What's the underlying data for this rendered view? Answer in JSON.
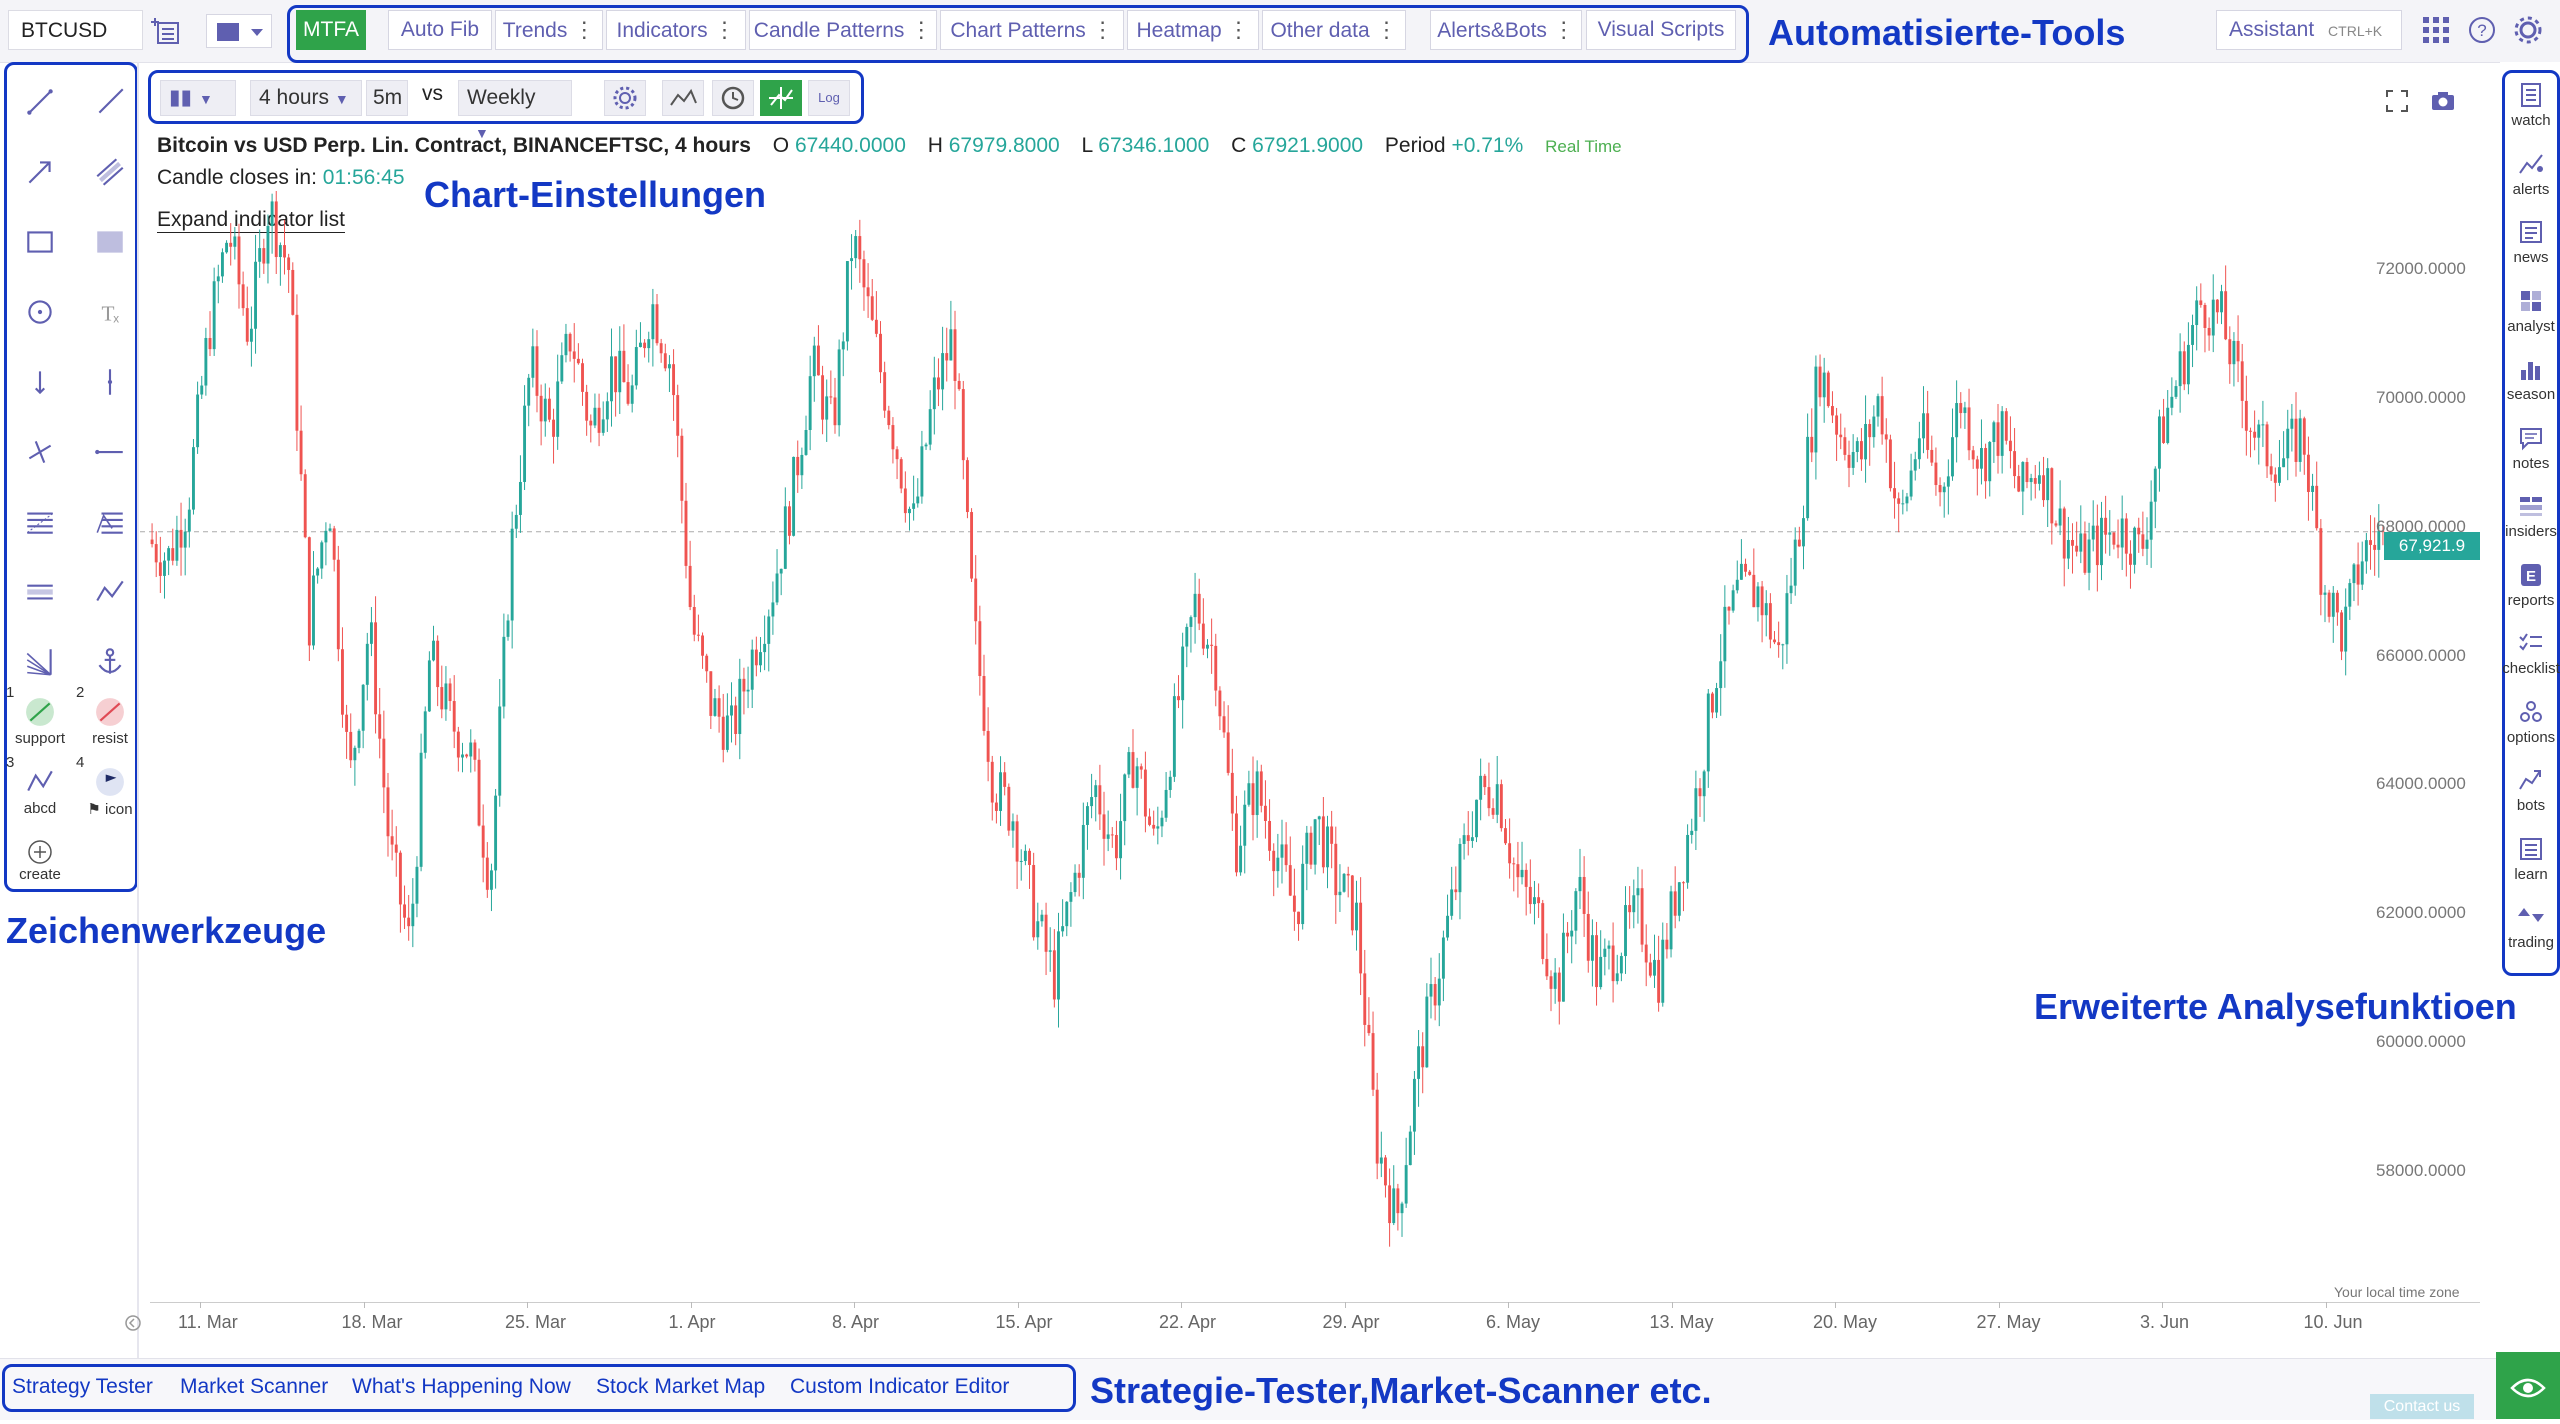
{
  "topbar": {
    "symbol": "BTCUSD",
    "buttons": [
      "MTFA",
      "Auto Fib",
      "Trends",
      "Indicators",
      "Candle Patterns",
      "Chart Patterns",
      "Heatmap",
      "Other data",
      "Alerts&Bots",
      "Visual Scripts"
    ],
    "assistant": "Assistant",
    "assistant_shortcut": "CTRL+K",
    "accent_color": "#5f5fb0",
    "active_color": "#2fa34a"
  },
  "annotations": {
    "tools": "Automatisierte-Tools",
    "chart_settings": "Chart-Einstellungen",
    "drawing": "Zeichenwerkzeuge",
    "advanced": "Erweiterte Analysefunktioen",
    "strategy": "Strategie-Tester,Market-Scanner etc."
  },
  "chart_toolbar": {
    "interval": "4 hours",
    "sub_interval": "5m",
    "vs": "vs",
    "compare": "Weekly",
    "log": "Log"
  },
  "legend": {
    "title": "Bitcoin vs USD Perp. Lin. Contract, BINANCEFTSC, 4 hours",
    "o_label": "O",
    "o": "67440.0000",
    "h_label": "H",
    "h": "67979.8000",
    "l_label": "L",
    "l": "67346.1000",
    "c_label": "C",
    "c": "67921.9000",
    "period_label": "Period",
    "period": "+0.71%",
    "realtime": "Real Time",
    "countdown_label": "Candle closes in:",
    "countdown": "01:56:45",
    "expand": "Expand indicator list"
  },
  "left_tools": {
    "presets": [
      {
        "num": "1",
        "label": "support"
      },
      {
        "num": "2",
        "label": "resist"
      },
      {
        "num": "3",
        "label": "abcd"
      },
      {
        "num": "4",
        "label": "⚑ icon"
      }
    ],
    "create": "create"
  },
  "right_sidebar": [
    "watch",
    "alerts",
    "news",
    "analyst",
    "season",
    "notes",
    "insiders",
    "reports",
    "checklist",
    "options",
    "bots",
    "learn",
    "trading"
  ],
  "bottom_links": [
    "Strategy Tester",
    "Market Scanner",
    "What's Happening Now",
    "Stock Market Map",
    "Custom Indicator Editor"
  ],
  "contact": "Contact us",
  "timezone": "Your local time zone",
  "price_label": "67,921.9",
  "chart_data": {
    "type": "candlestick",
    "title": "Bitcoin vs USD Perp. Lin. Contract, BINANCEFTSC, 4 hours",
    "y_ticks": [
      "72000.0000",
      "70000.0000",
      "68000.0000",
      "66000.0000",
      "64000.0000",
      "62000.0000",
      "60000.0000",
      "58000.0000"
    ],
    "x_ticks": [
      "11. Mar",
      "18. Mar",
      "25. Mar",
      "1. Apr",
      "8. Apr",
      "15. Apr",
      "22. Apr",
      "29. Apr",
      "6. May",
      "13. May",
      "20. May",
      "27. May",
      "3. Jun",
      "10. Jun"
    ],
    "ylim": [
      56000,
      74000
    ],
    "last_price": 67921.9,
    "up_color": "#26a69a",
    "down_color": "#ef5350",
    "path": [
      [
        0,
        67800
      ],
      [
        1,
        67500
      ],
      [
        2,
        68400
      ],
      [
        3,
        71000
      ],
      [
        4,
        72600
      ],
      [
        5,
        71000
      ],
      [
        6,
        73000
      ],
      [
        7,
        72000
      ],
      [
        8,
        66500
      ],
      [
        9,
        68500
      ],
      [
        10,
        64000
      ],
      [
        11,
        66500
      ],
      [
        12,
        63000
      ],
      [
        13,
        61500
      ],
      [
        14,
        66000
      ],
      [
        15,
        65000
      ],
      [
        16,
        64500
      ],
      [
        17,
        62500
      ],
      [
        18,
        67500
      ],
      [
        19,
        70500
      ],
      [
        20,
        69500
      ],
      [
        21,
        71000
      ],
      [
        22,
        69500
      ],
      [
        23,
        70500
      ],
      [
        24,
        70000
      ],
      [
        25,
        71500
      ],
      [
        26,
        70500
      ],
      [
        27,
        66500
      ],
      [
        28,
        65200
      ],
      [
        29,
        64800
      ],
      [
        30,
        66000
      ],
      [
        31,
        67000
      ],
      [
        32,
        68500
      ],
      [
        33,
        70500
      ],
      [
        34,
        69500
      ],
      [
        35,
        72500
      ],
      [
        36,
        71000
      ],
      [
        37,
        69500
      ],
      [
        38,
        68000
      ],
      [
        39,
        70000
      ],
      [
        40,
        71000
      ],
      [
        41,
        66500
      ],
      [
        42,
        64000
      ],
      [
        43,
        63500
      ],
      [
        44,
        62000
      ],
      [
        45,
        61000
      ],
      [
        46,
        62500
      ],
      [
        47,
        64000
      ],
      [
        48,
        63000
      ],
      [
        49,
        64500
      ],
      [
        50,
        63000
      ],
      [
        51,
        65000
      ],
      [
        52,
        66800
      ],
      [
        53,
        66000
      ],
      [
        54,
        63000
      ],
      [
        55,
        64000
      ],
      [
        56,
        63000
      ],
      [
        57,
        62000
      ],
      [
        58,
        63500
      ],
      [
        59,
        62500
      ],
      [
        60,
        62000
      ],
      [
        61,
        58500
      ],
      [
        62,
        57200
      ],
      [
        63,
        59500
      ],
      [
        64,
        61000
      ],
      [
        65,
        62500
      ],
      [
        66,
        63800
      ],
      [
        67,
        64000
      ],
      [
        68,
        62500
      ],
      [
        69,
        62000
      ],
      [
        70,
        60800
      ],
      [
        71,
        62500
      ],
      [
        72,
        61000
      ],
      [
        73,
        61500
      ],
      [
        74,
        62000
      ],
      [
        75,
        61000
      ],
      [
        76,
        62500
      ],
      [
        77,
        64000
      ],
      [
        78,
        66000
      ],
      [
        79,
        67000
      ],
      [
        80,
        67000
      ],
      [
        81,
        66000
      ],
      [
        82,
        68000
      ],
      [
        83,
        70500
      ],
      [
        84,
        69500
      ],
      [
        85,
        69000
      ],
      [
        86,
        70000
      ],
      [
        87,
        68000
      ],
      [
        88,
        69500
      ],
      [
        89,
        68500
      ],
      [
        90,
        70000
      ],
      [
        91,
        69000
      ],
      [
        92,
        69500
      ],
      [
        93,
        68500
      ],
      [
        94,
        69000
      ],
      [
        95,
        68000
      ],
      [
        96,
        67500
      ],
      [
        97,
        67800
      ],
      [
        98,
        68000
      ],
      [
        99,
        67600
      ],
      [
        100,
        69500
      ],
      [
        101,
        70500
      ],
      [
        102,
        71500
      ],
      [
        103,
        71200
      ],
      [
        104,
        70000
      ],
      [
        105,
        69200
      ],
      [
        106,
        69000
      ],
      [
        107,
        69500
      ],
      [
        108,
        67200
      ],
      [
        109,
        66300
      ],
      [
        110,
        67600
      ],
      [
        111,
        67900
      ]
    ]
  }
}
